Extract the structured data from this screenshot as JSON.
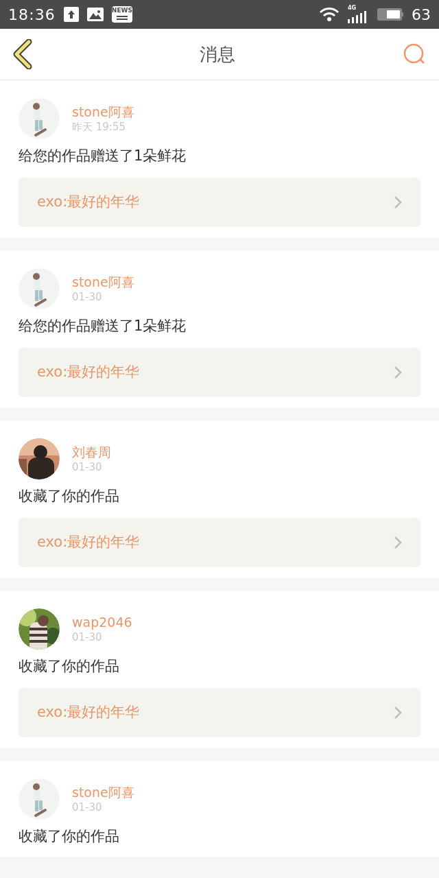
{
  "status_bar": {
    "time": "18:36",
    "news_label": "NEWS",
    "network": "4G",
    "battery": "63"
  },
  "header": {
    "title": "消息"
  },
  "messages": [
    {
      "name": "stone阿喜",
      "time": "昨天 19:55",
      "text": "给您的作品赠送了1朵鲜花",
      "work": "exo:最好的年华"
    },
    {
      "name": "stone阿喜",
      "time": "01-30",
      "text": "给您的作品赠送了1朵鲜花",
      "work": "exo:最好的年华"
    },
    {
      "name": "刘春周",
      "time": "01-30",
      "text": "收藏了你的作品",
      "work": "exo:最好的年华"
    },
    {
      "name": "wap2046",
      "time": "01-30",
      "text": "收藏了你的作品",
      "work": "exo:最好的年华"
    },
    {
      "name": "stone阿喜",
      "time": "01-30",
      "text": "收藏了你的作品"
    }
  ]
}
